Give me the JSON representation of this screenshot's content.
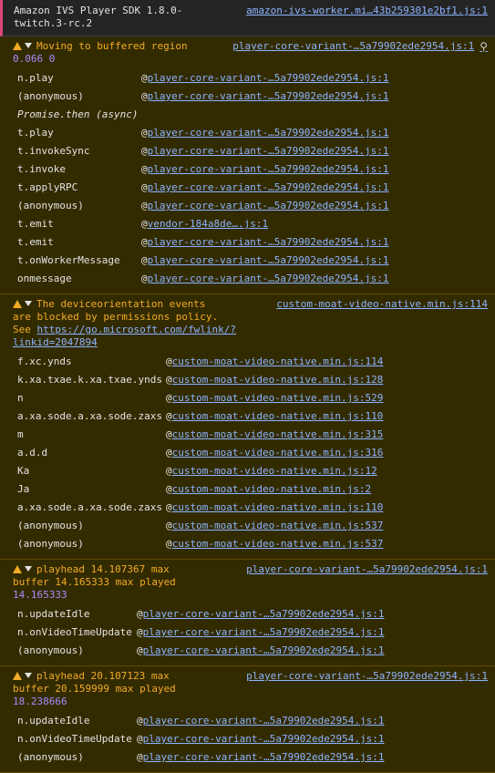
{
  "info_message": {
    "text": "Amazon IVS Player SDK 1.8.0-\ntwitch.3-rc.2",
    "source": "amazon-ivs-worker.mi…43b259301e2bf1.js:1"
  },
  "warnings": [
    {
      "prefix": "Moving to buffered region",
      "value_line": "0.066 0",
      "source": "player-core-variant-…5a79902ede2954.js:1",
      "frames": [
        {
          "fn": "n.play",
          "loc": "player-core-variant-…5a79902ede2954.js:1"
        },
        {
          "fn": "(anonymous)",
          "loc": "player-core-variant-…5a79902ede2954.js:1"
        },
        {
          "fn": "Promise.then (async)",
          "loc": ""
        },
        {
          "fn": "t.play",
          "loc": "player-core-variant-…5a79902ede2954.js:1"
        },
        {
          "fn": "t.invokeSync",
          "loc": "player-core-variant-…5a79902ede2954.js:1"
        },
        {
          "fn": "t.invoke",
          "loc": "player-core-variant-…5a79902ede2954.js:1"
        },
        {
          "fn": "t.applyRPC",
          "loc": "player-core-variant-…5a79902ede2954.js:1"
        },
        {
          "fn": "(anonymous)",
          "loc": "player-core-variant-…5a79902ede2954.js:1"
        },
        {
          "fn": "t.emit",
          "loc": "vendor-184a8de….js:1"
        },
        {
          "fn": "t.emit",
          "loc": "player-core-variant-…5a79902ede2954.js:1"
        },
        {
          "fn": "t.onWorkerMessage",
          "loc": "player-core-variant-…5a79902ede2954.js:1"
        },
        {
          "fn": "onmessage",
          "loc": "player-core-variant-…5a79902ede2954.js:1"
        }
      ]
    },
    {
      "line1": "The deviceorientation events",
      "line2": "are blocked by permissions policy.",
      "line3_prefix": "See ",
      "line3_link": "https://go.microsoft.com/fwlink/?linkid=2047894",
      "source": "custom-moat-video-native.min.js:114",
      "frames": [
        {
          "fn": "f.xc.ynds",
          "loc": "custom-moat-video-native.min.js:114"
        },
        {
          "fn": "k.xa.txae.k.xa.txae.ynds",
          "loc": "custom-moat-video-native.min.js:128"
        },
        {
          "fn": "n",
          "loc": "custom-moat-video-native.min.js:529"
        },
        {
          "fn": "a.xa.sode.a.xa.sode.zaxs",
          "loc": "custom-moat-video-native.min.js:110"
        },
        {
          "fn": "m",
          "loc": "custom-moat-video-native.min.js:315"
        },
        {
          "fn": "a.d.d",
          "loc": "custom-moat-video-native.min.js:316"
        },
        {
          "fn": "Ka",
          "loc": "custom-moat-video-native.min.js:12"
        },
        {
          "fn": "Ja",
          "loc": "custom-moat-video-native.min.js:2"
        },
        {
          "fn": "a.xa.sode.a.xa.sode.zaxs",
          "loc": "custom-moat-video-native.min.js:110"
        },
        {
          "fn": "(anonymous)",
          "loc": "custom-moat-video-native.min.js:537"
        },
        {
          "fn": "(anonymous)",
          "loc": "custom-moat-video-native.min.js:537"
        }
      ]
    },
    {
      "line1": "playhead 14.107367 max",
      "line2": "buffer 14.165333 max played",
      "line3": "14.165333",
      "source": "player-core-variant-…5a79902ede2954.js:1",
      "frames": [
        {
          "fn": "n.updateIdle",
          "loc": "player-core-variant-…5a79902ede2954.js:1"
        },
        {
          "fn": "n.onVideoTimeUpdate",
          "loc": "player-core-variant-…5a79902ede2954.js:1"
        },
        {
          "fn": "(anonymous)",
          "loc": "player-core-variant-…5a79902ede2954.js:1"
        }
      ]
    },
    {
      "line1": "playhead 20.107123 max",
      "line2": "buffer 20.159999 max played",
      "line3": "18.238666",
      "source": "player-core-variant-…5a79902ede2954.js:1",
      "frames": [
        {
          "fn": "n.updateIdle",
          "loc": "player-core-variant-…5a79902ede2954.js:1"
        },
        {
          "fn": "n.onVideoTimeUpdate",
          "loc": "player-core-variant-…5a79902ede2954.js:1"
        },
        {
          "fn": "(anonymous)",
          "loc": "player-core-variant-…5a79902ede2954.js:1"
        }
      ]
    }
  ],
  "at_sign": "@",
  "search_glyph": "⚲",
  "colors": {
    "background": "#242424",
    "warning_background": "#332b00",
    "warning_text": "#f2ab26",
    "link": "#8cb4ff",
    "number": "#a48dff",
    "info_marker": "#e0447d"
  }
}
